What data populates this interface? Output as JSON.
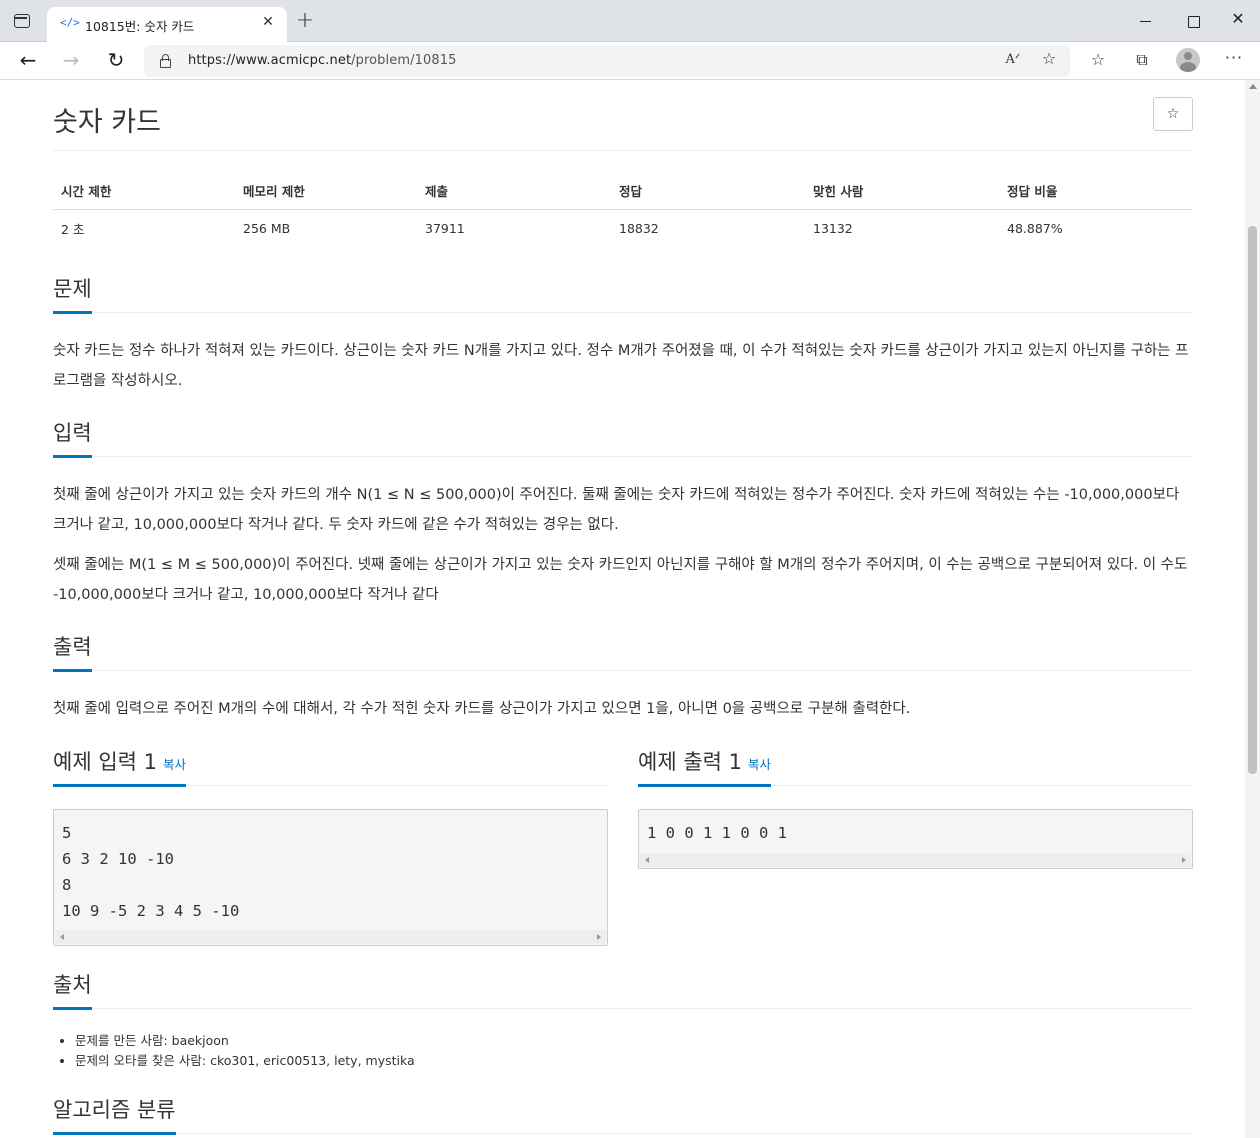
{
  "browser": {
    "tab_title": "10815번: 숫자 카드",
    "tab_favicon": "</>",
    "url_host": "https://www.acmicpc.net",
    "url_path": "/problem/10815",
    "icons": {
      "tab_actions": "tab-actions-icon",
      "close_tab": "close-icon",
      "new_tab": "plus-icon",
      "back": "back-arrow-icon",
      "forward": "forward-arrow-icon",
      "reload": "reload-icon",
      "lock": "lock-icon",
      "read_aloud": "read-aloud-icon",
      "add_favorite": "star-add-icon",
      "favorites": "favorites-icon",
      "collections": "collections-icon",
      "profile": "profile-avatar",
      "more": "more-icon"
    },
    "glyphs": {
      "close": "✕",
      "new_tab": "+",
      "back": "←",
      "forward": "→",
      "reload": "↻",
      "read_aloud": "Aᐟ",
      "add_favorite": "☆",
      "favorites": "☆",
      "collections": "⧉",
      "more": "···",
      "win_close": "✕"
    }
  },
  "problem": {
    "title": "숫자 카드",
    "star_glyph": "☆",
    "info_headers": [
      "시간 제한",
      "메모리 제한",
      "제출",
      "정답",
      "맞힌 사람",
      "정답 비율"
    ],
    "info_values": [
      "2 초",
      "256 MB",
      "37911",
      "18832",
      "13132",
      "48.887%"
    ],
    "sections": {
      "description_title": "문제",
      "description": "숫자 카드는 정수 하나가 적혀져 있는 카드이다. 상근이는 숫자 카드 N개를 가지고 있다. 정수 M개가 주어졌을 때, 이 수가 적혀있는 숫자 카드를 상근이가 가지고 있는지 아닌지를 구하는 프로그램을 작성하시오.",
      "input_title": "입력",
      "input_p1": "첫째 줄에 상근이가 가지고 있는 숫자 카드의 개수 N(1 ≤ N ≤ 500,000)이 주어진다. 둘째 줄에는 숫자 카드에 적혀있는 정수가 주어진다. 숫자 카드에 적혀있는 수는 -10,000,000보다 크거나 같고, 10,000,000보다 작거나 같다. 두 숫자 카드에 같은 수가 적혀있는 경우는 없다.",
      "input_p2": "셋째 줄에는 M(1 ≤ M ≤ 500,000)이 주어진다. 넷째 줄에는 상근이가 가지고 있는 숫자 카드인지 아닌지를 구해야 할 M개의 정수가 주어지며, 이 수는 공백으로 구분되어져 있다. 이 수도 -10,000,000보다 크거나 같고, 10,000,000보다 작거나 같다",
      "output_title": "출력",
      "output": "첫째 줄에 입력으로 주어진 M개의 수에 대해서, 각 수가 적힌 숫자 카드를 상근이가 가지고 있으면 1을, 아니면 0을 공백으로 구분해 출력한다.",
      "sample_input_title": "예제 입력 1",
      "sample_output_title": "예제 출력 1",
      "copy_label": "복사",
      "sample_input": "5\n6 3 2 10 -10\n8\n10 9 -5 2 3 4 5 -10",
      "sample_output": "1 0 0 1 1 0 0 1",
      "source_title": "출처",
      "source_items": [
        "문제를 만든 사람: baekjoon",
        "문제의 오타를 찾은 사람: cko301, eric00513, lety, mystika"
      ],
      "algorithm_title": "알고리즘 분류"
    },
    "accent_color": "#0076c0"
  }
}
